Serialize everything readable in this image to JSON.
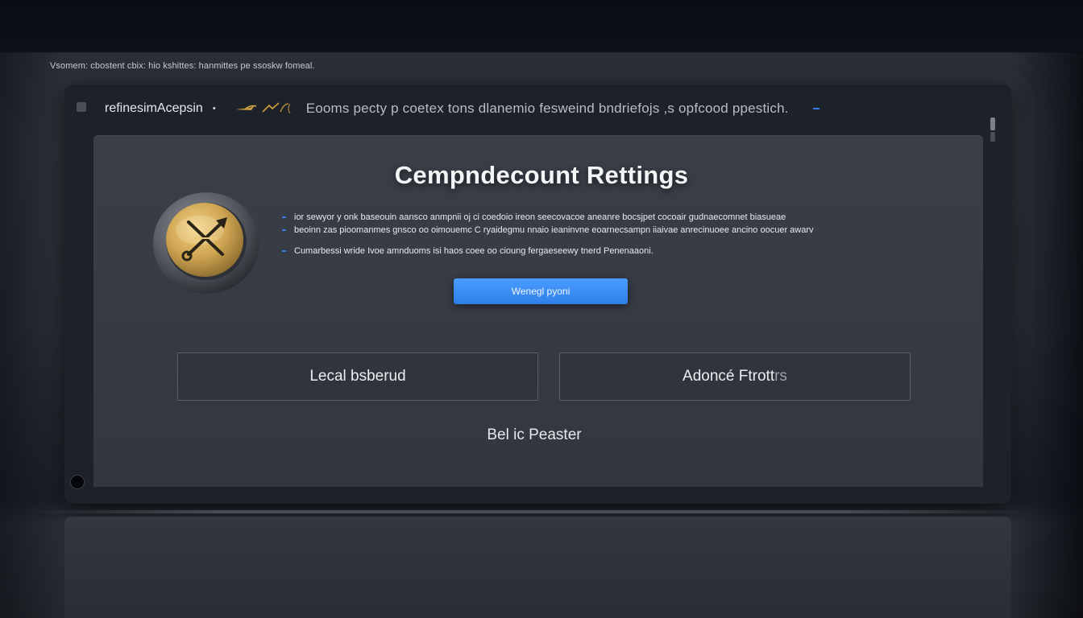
{
  "caption": "Vsomem: cbostent cbix: hio kshittes: hanmittes pe ssoskw fomeal.",
  "titlebar": {
    "app_name": "refinesimAcepsin",
    "caret": "•",
    "path": "Eooms pecty p coetex tons dlanemio fesweind bndriefojs ,s opfcood ppestich."
  },
  "panel": {
    "title": "Cempndecount Rettings",
    "description_lines": [
      "ior sewyor y onk baseouin aansco anmpnii oj ci coedoio ireon seecovacoe aneanre bocsjpet cocoair gudnaecomnet biasueae",
      "beoinn zas pioomanmes gnsco oo oimouemc C ryaidegmu nnaio ieaninvne eoarnecsampn iiaivae anrecinuoee ancino oocuer awarv",
      "Cumarbessi wride Ivoe amnduoms isi haos coee oo cioung fergaeseewy tnerd Penenaaoni."
    ],
    "primary_button": "Wenegl pyoni",
    "option_left": "Lecal bsberud",
    "option_right_main": "Adoncé Ftrott",
    "option_right_fade": "rs",
    "footer_link": "Bel ic Peaster"
  },
  "colors": {
    "accent_blue": "#3c8af5",
    "panel_bg": "#383c45",
    "emblem_gold": "#c9a455"
  },
  "icons": {
    "emblem": "gold-seal-crossed-tools-icon",
    "feather": "feather-quill-icon"
  }
}
